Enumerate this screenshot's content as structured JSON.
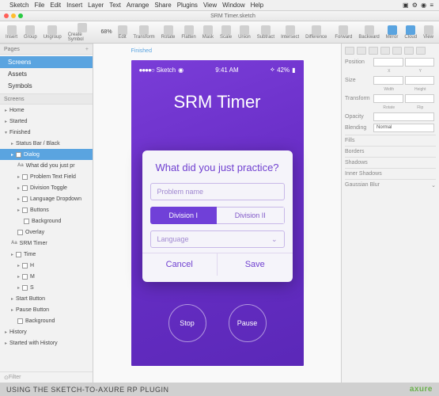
{
  "macbar": {
    "menus": [
      "Sketch",
      "File",
      "Edit",
      "Insert",
      "Layer",
      "Text",
      "Arrange",
      "Share",
      "Plugins",
      "View",
      "Window",
      "Help"
    ]
  },
  "titlebar": {
    "title": "SRM Timer.sketch"
  },
  "toolbar": {
    "items": [
      "Insert",
      "Group",
      "Ungroup",
      "Create Symbol"
    ],
    "zoom": "68%",
    "center": [
      "Edit",
      "Transform",
      "Rotate",
      "Flatten",
      "Mask",
      "Scale",
      "Union",
      "Subtract",
      "Intersect",
      "Difference"
    ],
    "right": [
      "Forward",
      "Backward",
      "Mirror",
      "Cloud",
      "View"
    ]
  },
  "left": {
    "pages_hdr": "Pages",
    "pages": [
      "Screens",
      "Assets",
      "Symbols"
    ],
    "screens_hdr": "Screens",
    "layers": [
      {
        "l": "Home",
        "d": 0,
        "t": "tri"
      },
      {
        "l": "Started",
        "d": 0,
        "t": "tri"
      },
      {
        "l": "Finished",
        "d": 0,
        "t": "tri-open",
        "sel": false
      },
      {
        "l": "Status Bar / Black",
        "d": 1,
        "t": "tri"
      },
      {
        "l": "Dialog",
        "d": 1,
        "t": "sq",
        "sel": true
      },
      {
        "l": "What did you just pr",
        "d": 2,
        "t": "txt"
      },
      {
        "l": "Problem Text Field",
        "d": 2,
        "t": "sq"
      },
      {
        "l": "Division Toggle",
        "d": 2,
        "t": "sq"
      },
      {
        "l": "Language Dropdown",
        "d": 2,
        "t": "sq"
      },
      {
        "l": "Buttons",
        "d": 2,
        "t": "sq"
      },
      {
        "l": "Background",
        "d": 3,
        "t": "rect"
      },
      {
        "l": "Overlay",
        "d": 2,
        "t": "rect"
      },
      {
        "l": "SRM Timer",
        "d": 1,
        "t": "txt"
      },
      {
        "l": "Time",
        "d": 1,
        "t": "sq"
      },
      {
        "l": "H",
        "d": 2,
        "t": "sq"
      },
      {
        "l": "M",
        "d": 2,
        "t": "sq"
      },
      {
        "l": "S",
        "d": 2,
        "t": "sq"
      },
      {
        "l": "Start Button",
        "d": 1,
        "t": "tri"
      },
      {
        "l": "Pause Button",
        "d": 1,
        "t": "tri"
      },
      {
        "l": "Background",
        "d": 2,
        "t": "rect"
      },
      {
        "l": "History",
        "d": 0,
        "t": "tri"
      },
      {
        "l": "Started with History",
        "d": 0,
        "t": "tri"
      }
    ],
    "filter": "Filter"
  },
  "canvas": {
    "artboard_label": "Finished",
    "status": {
      "carrier": "Sketch",
      "time": "9:41 AM",
      "battery": "42%"
    },
    "title": "SRM Timer",
    "dialog": {
      "heading": "What did you just practice?",
      "placeholder": "Problem name",
      "div1": "Division I",
      "div2": "Division II",
      "lang": "Language",
      "cancel": "Cancel",
      "save": "Save"
    },
    "stop": "Stop",
    "pause": "Pause"
  },
  "right": {
    "position": "Position",
    "size": "Size",
    "width": "Width",
    "height": "Height",
    "transform": "Transform",
    "rotate": "Rotate",
    "flip": "Flip",
    "opacity": "Opacity",
    "blending": "Blending",
    "blend_val": "Normal",
    "sections": [
      "Fills",
      "Borders",
      "Shadows",
      "Inner Shadows",
      "Gaussian Blur"
    ]
  },
  "caption": {
    "text": "USING THE SKETCH-TO-AXURE RP PLUGIN",
    "logo": "axure"
  }
}
